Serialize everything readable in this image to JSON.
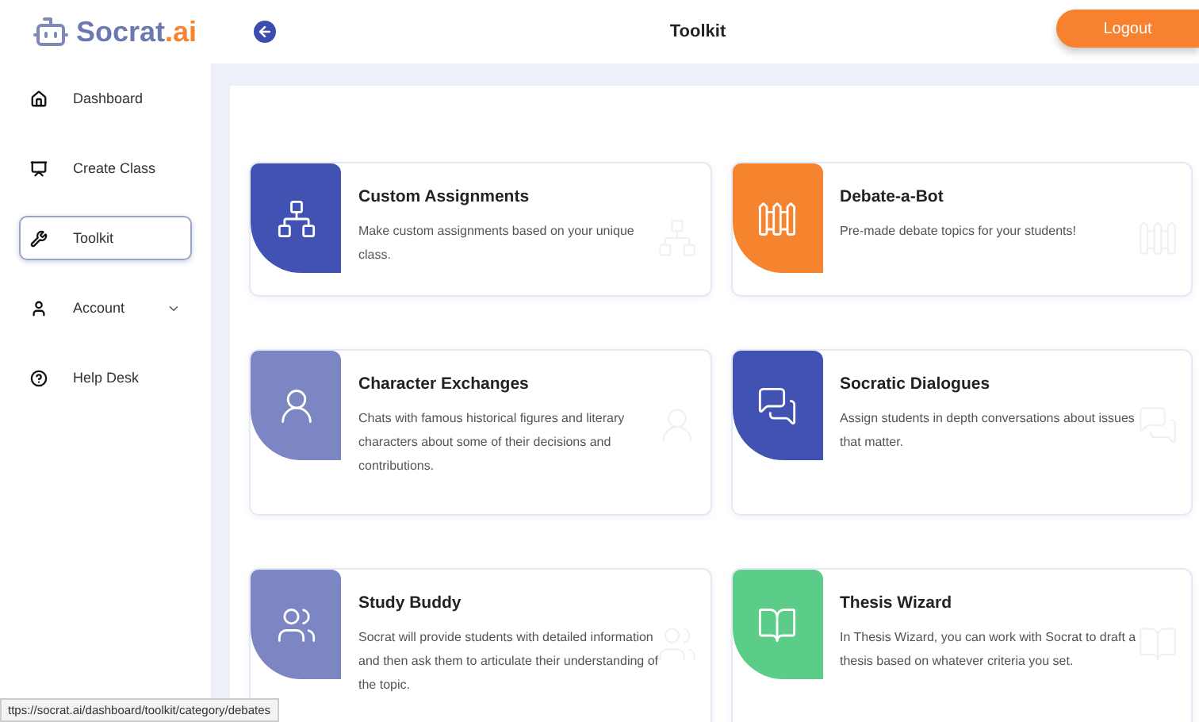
{
  "header": {
    "logo": {
      "name": "Socrat",
      "suffix": ".ai"
    },
    "title": "Toolkit",
    "logout": "Logout"
  },
  "sidebar": {
    "items": [
      {
        "label": "Dashboard",
        "selected": false
      },
      {
        "label": "Create Class",
        "selected": false
      },
      {
        "label": "Toolkit",
        "selected": true
      },
      {
        "label": "Account",
        "selected": false,
        "expandable": true
      },
      {
        "label": "Help Desk",
        "selected": false
      }
    ]
  },
  "cards": [
    {
      "title": "Custom Assignments",
      "description": "Make custom assignments based on your unique class.",
      "color": "#4152b3"
    },
    {
      "title": "Debate-a-Bot",
      "description": "Pre-made debate topics for your students!",
      "color": "#f6842f"
    },
    {
      "title": "Character Exchanges",
      "description": "Chats with famous historical figures and literary characters about some of their decisions and contributions.",
      "color": "#7c86c2"
    },
    {
      "title": "Socratic Dialogues",
      "description": "Assign students in depth conversations about issues that matter.",
      "color": "#4152b3"
    },
    {
      "title": "Study Buddy",
      "description": "Socrat will provide students with detailed information and then ask them to articulate their understanding of the topic.",
      "color": "#7c86c2"
    },
    {
      "title": "Thesis Wizard",
      "description": "In Thesis Wizard, you can work with Socrat to draft a thesis based on whatever criteria you set.",
      "color": "#5ccd88"
    }
  ],
  "status_url": "ttps://socrat.ai/dashboard/toolkit/category/debates"
}
